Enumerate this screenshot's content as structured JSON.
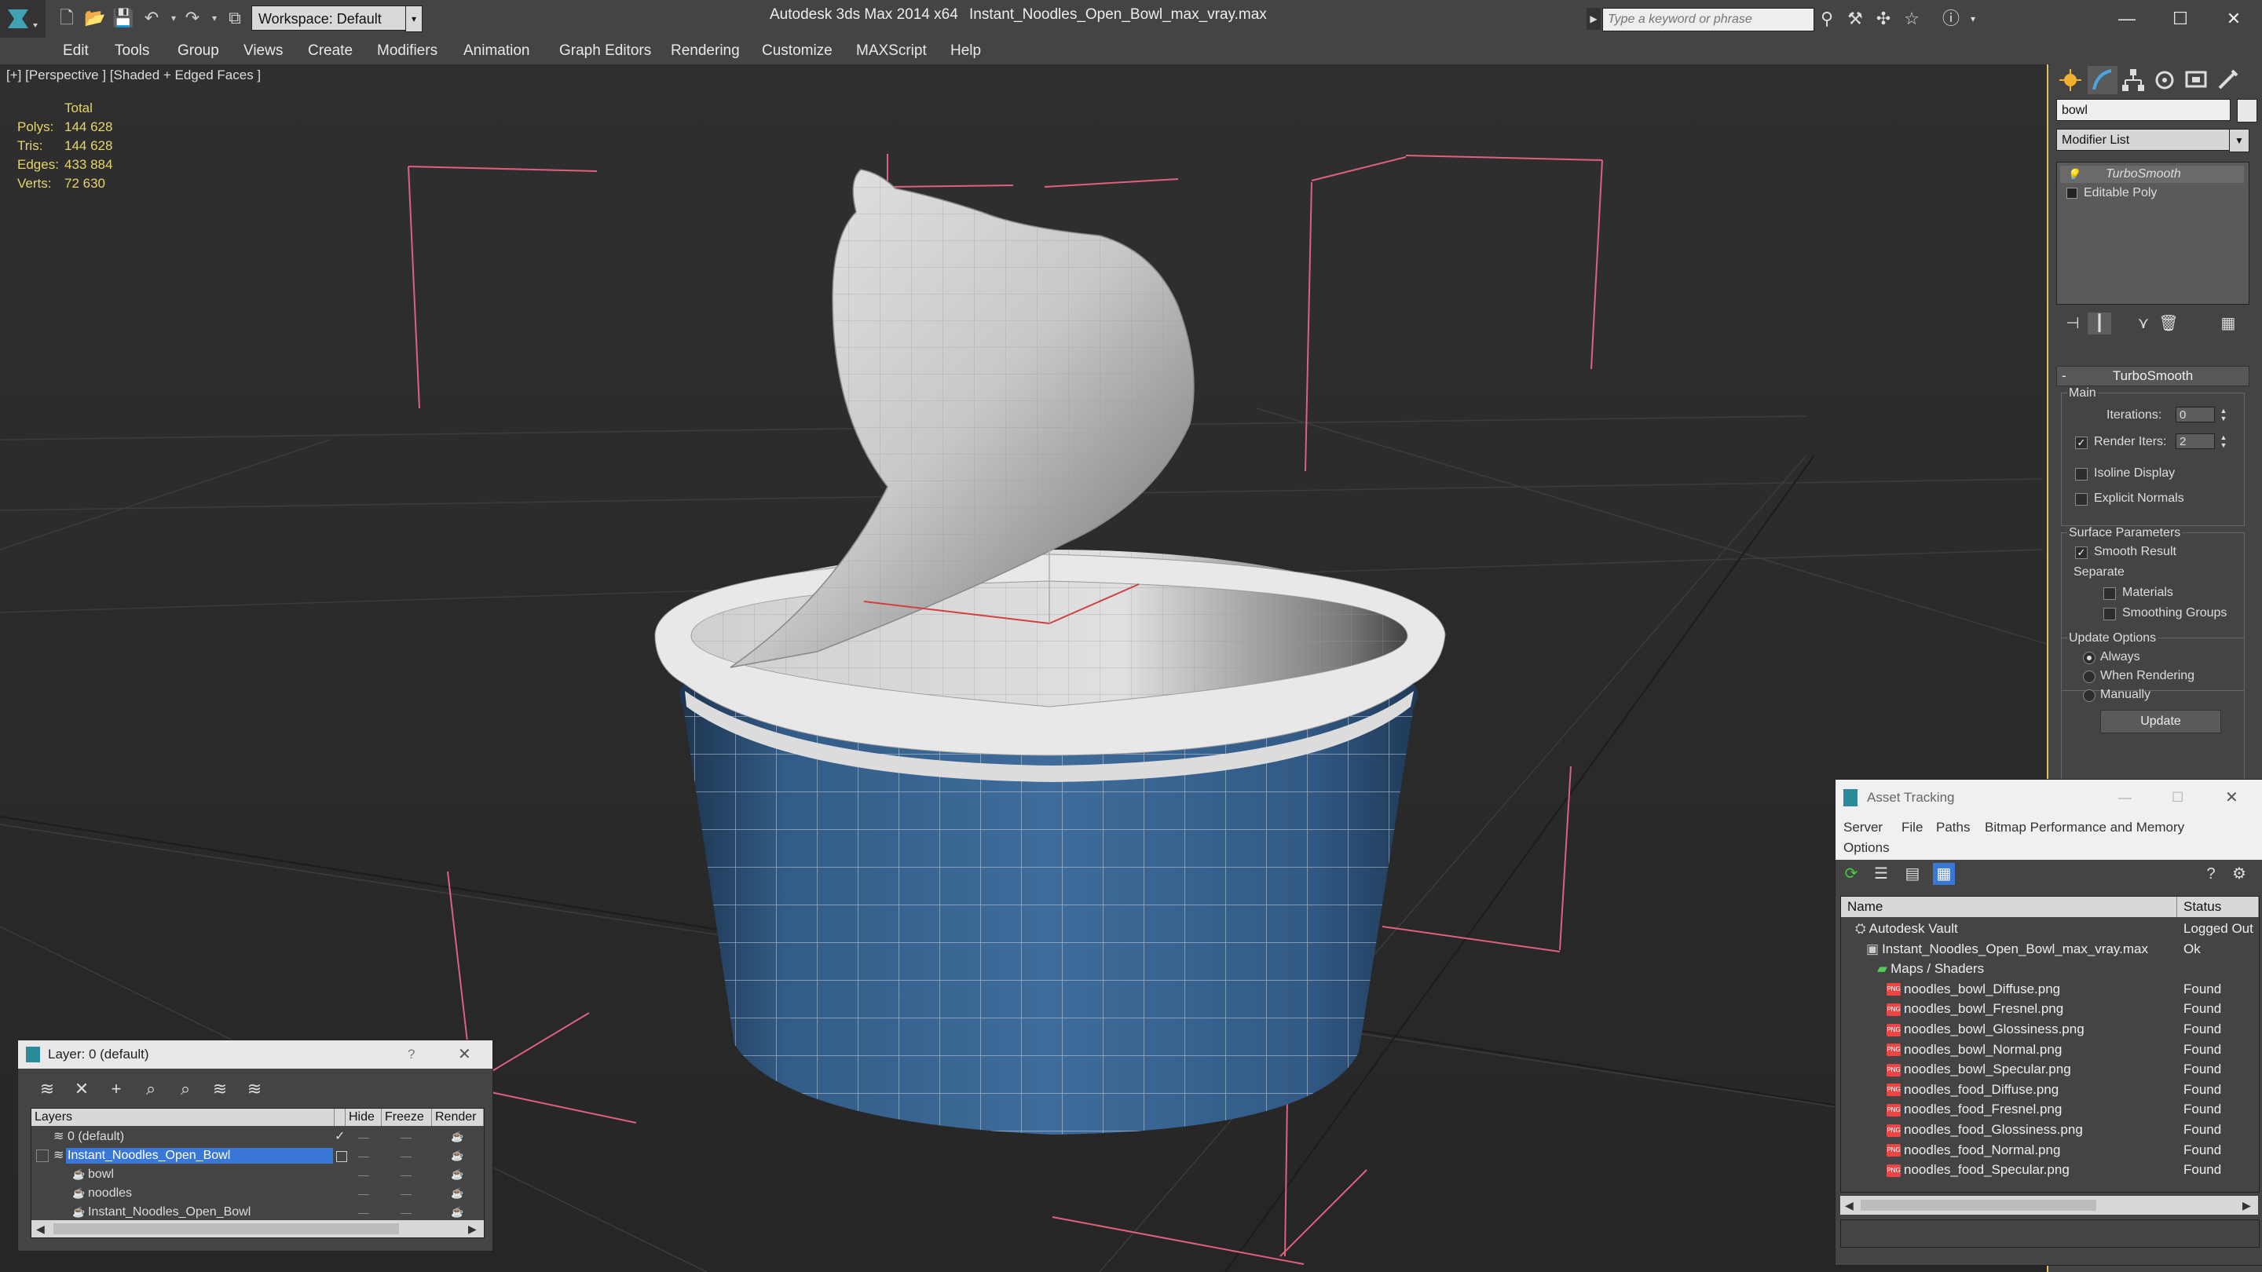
{
  "titlebar": {
    "workspace_label": "Workspace: Default",
    "app_title": "Autodesk 3ds Max  2014 x64",
    "file_title": "Instant_Noodles_Open_Bowl_max_vray.max",
    "search_placeholder": "Type a keyword or phrase"
  },
  "menu": [
    "Edit",
    "Tools",
    "Group",
    "Views",
    "Create",
    "Modifiers",
    "Animation",
    "Graph Editors",
    "Rendering",
    "Customize",
    "MAXScript",
    "Help"
  ],
  "viewport": {
    "label": "[+] [Perspective ] [Shaded + Edged Faces ]",
    "stats_header": "Total",
    "stats": [
      {
        "label": "Polys:",
        "value": "144 628"
      },
      {
        "label": "Tris:",
        "value": "144 628"
      },
      {
        "label": "Edges:",
        "value": "433 884"
      },
      {
        "label": "Verts:",
        "value": "72 630"
      }
    ]
  },
  "command_panel": {
    "object_name": "bowl",
    "modifier_list": "Modifier List",
    "stack": [
      "TurboSmooth",
      "Editable Poly"
    ],
    "rollout_title": "TurboSmooth",
    "main_label": "Main",
    "iterations_label": "Iterations:",
    "iterations_value": "0",
    "render_iters_label": "Render Iters:",
    "render_iters_value": "2",
    "isoline_label": "Isoline Display",
    "explicit_label": "Explicit Normals",
    "surface_label": "Surface Parameters",
    "smooth_label": "Smooth Result",
    "separate_label": "Separate",
    "materials_label": "Materials",
    "smoothing_groups_label": "Smoothing Groups",
    "update_options_label": "Update Options",
    "always_label": "Always",
    "when_rendering_label": "When Rendering",
    "manually_label": "Manually",
    "update_button": "Update"
  },
  "layer_dialog": {
    "title": "Layer: 0 (default)",
    "help": "?",
    "columns": [
      "Layers",
      "Hide",
      "Freeze",
      "Render"
    ],
    "rows": [
      {
        "name": "0 (default)",
        "indent": 1
      },
      {
        "name": "Instant_Noodles_Open_Bowl",
        "indent": 1,
        "selected": true
      },
      {
        "name": "bowl",
        "indent": 2
      },
      {
        "name": "noodles",
        "indent": 2
      },
      {
        "name": "Instant_Noodles_Open_Bowl",
        "indent": 2
      }
    ]
  },
  "asset_dialog": {
    "title": "Asset Tracking",
    "menu": [
      "Server",
      "File",
      "Paths",
      "Bitmap Performance and Memory",
      "Options"
    ],
    "columns": [
      "Name",
      "Status"
    ],
    "rows": [
      {
        "name": "Autodesk Vault",
        "status": "Logged Out",
        "indent": 1,
        "icon": "vault"
      },
      {
        "name": "Instant_Noodles_Open_Bowl_max_vray.max",
        "status": "Ok",
        "indent": 2,
        "icon": "max"
      },
      {
        "name": "Maps / Shaders",
        "status": "",
        "indent": 3,
        "icon": "folder"
      },
      {
        "name": "noodles_bowl_Diffuse.png",
        "status": "Found",
        "indent": 4,
        "icon": "png"
      },
      {
        "name": "noodles_bowl_Fresnel.png",
        "status": "Found",
        "indent": 4,
        "icon": "png"
      },
      {
        "name": "noodles_bowl_Glossiness.png",
        "status": "Found",
        "indent": 4,
        "icon": "png"
      },
      {
        "name": "noodles_bowl_Normal.png",
        "status": "Found",
        "indent": 4,
        "icon": "png"
      },
      {
        "name": "noodles_bowl_Specular.png",
        "status": "Found",
        "indent": 4,
        "icon": "png"
      },
      {
        "name": "noodles_food_Diffuse.png",
        "status": "Found",
        "indent": 4,
        "icon": "png"
      },
      {
        "name": "noodles_food_Fresnel.png",
        "status": "Found",
        "indent": 4,
        "icon": "png"
      },
      {
        "name": "noodles_food_Glossiness.png",
        "status": "Found",
        "indent": 4,
        "icon": "png"
      },
      {
        "name": "noodles_food_Normal.png",
        "status": "Found",
        "indent": 4,
        "icon": "png"
      },
      {
        "name": "noodles_food_Specular.png",
        "status": "Found",
        "indent": 4,
        "icon": "png"
      }
    ]
  },
  "colors": {
    "viewport_bg": "#2b2b2b",
    "bowl_blue": "#3d6a99",
    "gizmo_pink": "#e06080",
    "stats_yellow": "#e6d46a",
    "selection_blue": "#3a78d8"
  }
}
